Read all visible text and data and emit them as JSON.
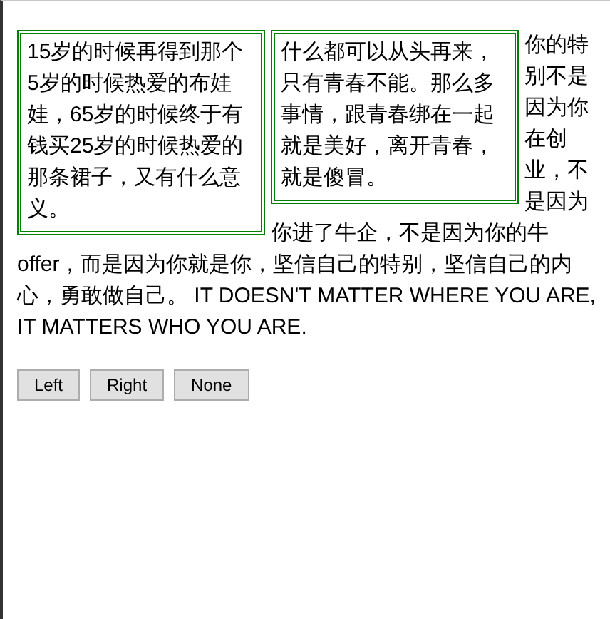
{
  "boxes": [
    {
      "text": "15岁的时候再得到那个5岁的时候热爱的布娃娃，65岁的时候终于有钱买25岁的时候热爱的那条裙子，又有什么意义。"
    },
    {
      "text": "什么都可以从头再来，只有青春不能。那么多事情，跟青春绑在一起就是美好，离开青春，就是傻冒。"
    }
  ],
  "paragraph": {
    "side": "你的特别不是因为你在创业，不是因为",
    "middle": "你进了牛企，不是因为你的牛",
    "rest": "offer，而是因为你就是你，坚信自己的特别，坚信自己的内心，勇敢做自己。 IT DOESN'T MATTER WHERE YOU ARE, IT MATTERS WHO YOU ARE."
  },
  "buttons": [
    "Left",
    "Right",
    "None"
  ]
}
